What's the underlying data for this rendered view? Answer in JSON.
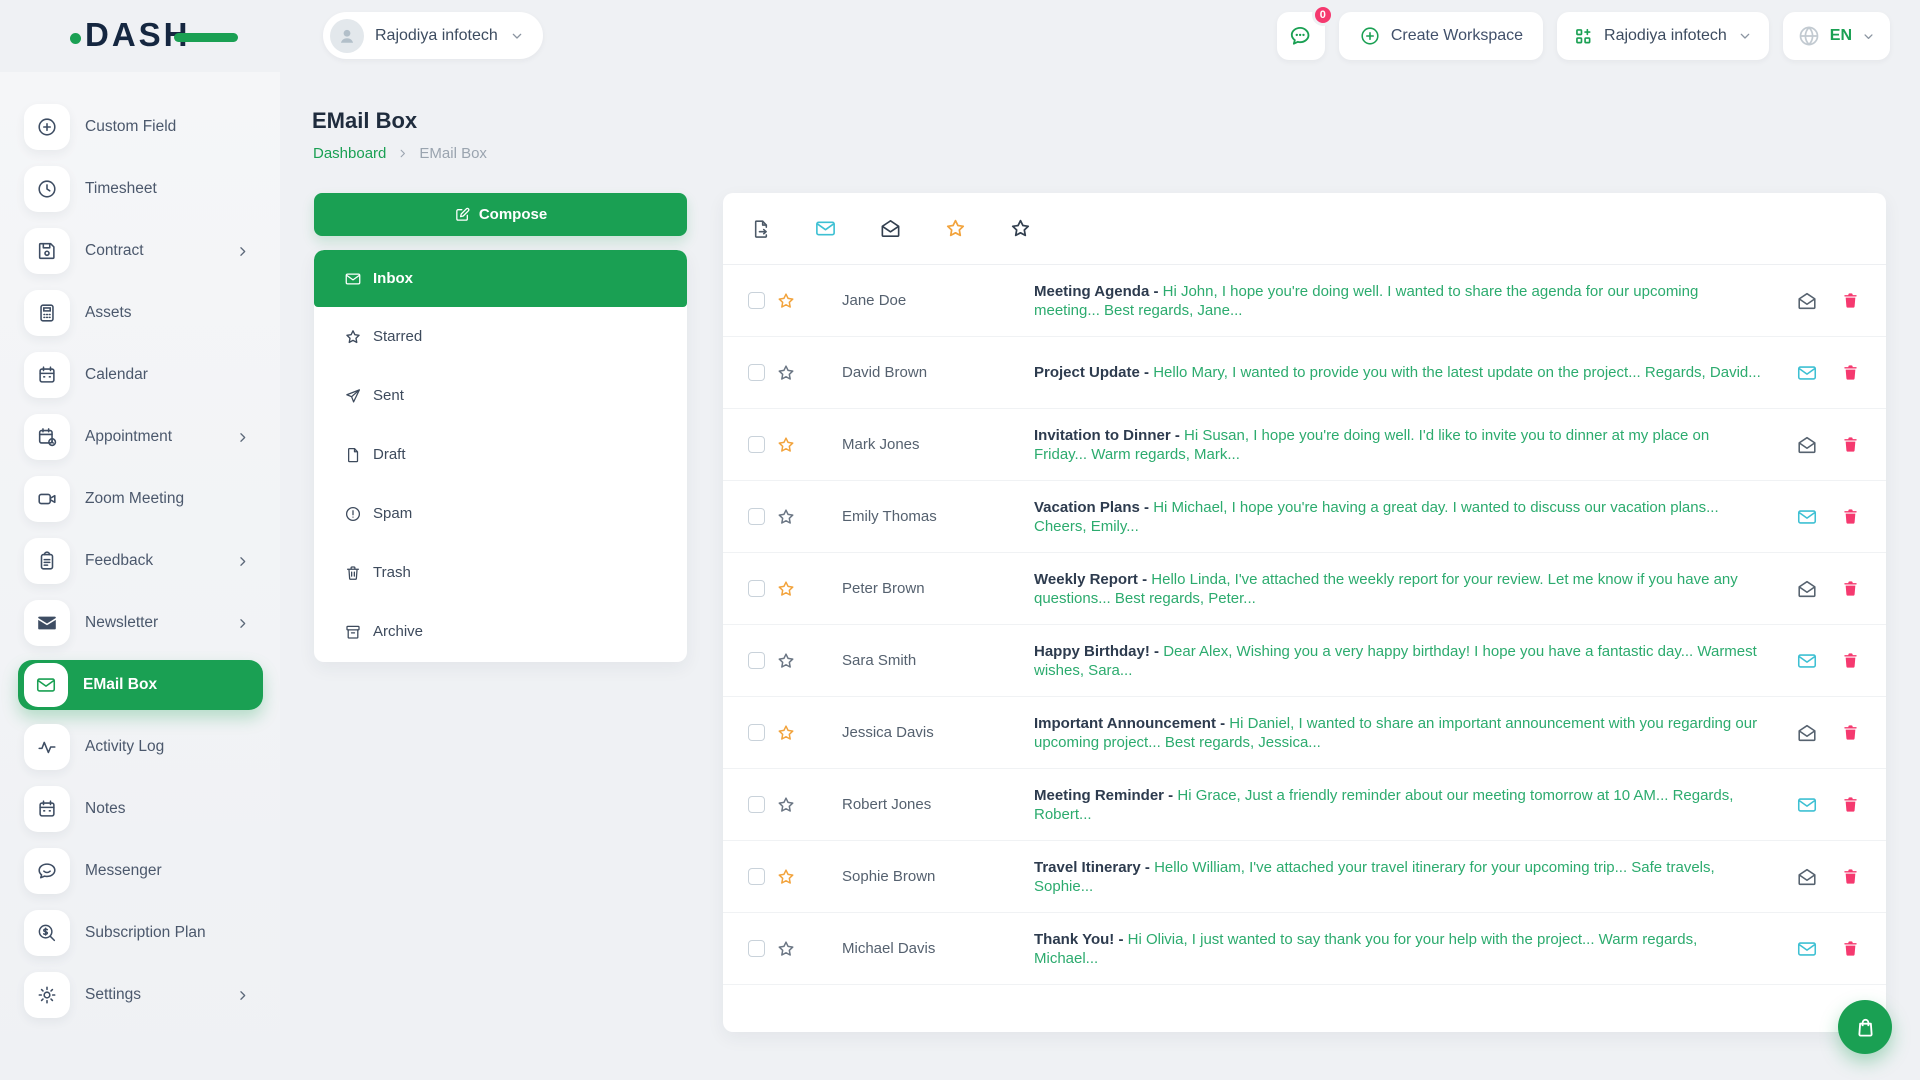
{
  "colors": {
    "accent_green": "#1aa053",
    "preview_green": "#2cab6e",
    "pink": "#f5396f",
    "cyan": "#3ec0d3",
    "star_orange": "#f2a33c",
    "dark_navy": "#152740"
  },
  "brand": {
    "logo_text": "DASH"
  },
  "header": {
    "user_dropdown": {
      "label": "Rajodiya infotech",
      "icon": "avatar-person-icon"
    },
    "chat": {
      "icon": "chat-bubble-icon",
      "badge": "0"
    },
    "create_workspace": {
      "label": "Create Workspace",
      "icon": "plus-circle-icon"
    },
    "workspace_dropdown": {
      "label": "Rajodiya infotech",
      "icon": "workspace-grid-icon"
    },
    "language": {
      "code": "EN",
      "icon": "globe-icon"
    }
  },
  "sidebar": {
    "items": [
      {
        "label": "Custom Field",
        "icon": "plus-circle-icon"
      },
      {
        "label": "Timesheet",
        "icon": "clock-icon"
      },
      {
        "label": "Contract",
        "icon": "save-icon",
        "has_submenu": true
      },
      {
        "label": "Assets",
        "icon": "calculator-icon"
      },
      {
        "label": "Calendar",
        "icon": "calendar-icon"
      },
      {
        "label": "Appointment",
        "icon": "calendar-clock-icon",
        "has_submenu": true
      },
      {
        "label": "Zoom Meeting",
        "icon": "video-camera-icon"
      },
      {
        "label": "Feedback",
        "icon": "clipboard-icon",
        "has_submenu": true
      },
      {
        "label": "Newsletter",
        "icon": "envelope-filled-icon",
        "has_submenu": true
      },
      {
        "label": "EMail Box",
        "icon": "envelope-icon",
        "active": true
      },
      {
        "label": "Activity Log",
        "icon": "activity-icon"
      },
      {
        "label": "Notes",
        "icon": "notes-calendar-icon"
      },
      {
        "label": "Messenger",
        "icon": "messenger-icon"
      },
      {
        "label": "Subscription Plan",
        "icon": "search-dollar-icon"
      },
      {
        "label": "Settings",
        "icon": "gear-icon",
        "has_submenu": true
      }
    ]
  },
  "page": {
    "title": "EMail Box",
    "breadcrumb": {
      "parent": "Dashboard",
      "current": "EMail Box"
    }
  },
  "mailbox": {
    "compose_label": "Compose",
    "folders": [
      {
        "label": "Inbox",
        "icon": "inbox-envelope-icon",
        "active": true
      },
      {
        "label": "Starred",
        "icon": "star-icon"
      },
      {
        "label": "Sent",
        "icon": "send-icon"
      },
      {
        "label": "Draft",
        "icon": "file-icon"
      },
      {
        "label": "Spam",
        "icon": "alert-circle-icon"
      },
      {
        "label": "Trash",
        "icon": "trash-icon"
      },
      {
        "label": "Archive",
        "icon": "archive-icon"
      }
    ],
    "toolbar": [
      {
        "name": "export-note-icon"
      },
      {
        "name": "mark-unread-envelope-icon"
      },
      {
        "name": "mark-read-envelope-icon"
      },
      {
        "name": "starred-filter-icon"
      },
      {
        "name": "unstarred-filter-icon"
      }
    ],
    "rows": [
      {
        "sender": "Jane Doe",
        "subject": "Meeting Agenda -",
        "preview": "Hi John, I hope you're doing well. I wanted to share the agenda for our upcoming meeting... Best regards, Jane...",
        "starred": true,
        "unread": false
      },
      {
        "sender": "David Brown",
        "subject": "Project Update -",
        "preview": "Hello Mary, I wanted to provide you with the latest update on the project... Regards, David...",
        "starred": false,
        "unread": true
      },
      {
        "sender": "Mark Jones",
        "subject": "Invitation to Dinner -",
        "preview": "Hi Susan, I hope you're doing well. I'd like to invite you to dinner at my place on Friday... Warm regards, Mark...",
        "starred": true,
        "unread": false
      },
      {
        "sender": "Emily Thomas",
        "subject": "Vacation Plans -",
        "preview": "Hi Michael, I hope you're having a great day. I wanted to discuss our vacation plans... Cheers, Emily...",
        "starred": false,
        "unread": true
      },
      {
        "sender": "Peter Brown",
        "subject": "Weekly Report -",
        "preview": "Hello Linda, I've attached the weekly report for your review. Let me know if you have any questions... Best regards, Peter...",
        "starred": true,
        "unread": false
      },
      {
        "sender": "Sara Smith",
        "subject": "Happy Birthday! -",
        "preview": "Dear Alex, Wishing you a very happy birthday! I hope you have a fantastic day... Warmest wishes, Sara...",
        "starred": false,
        "unread": true
      },
      {
        "sender": "Jessica Davis",
        "subject": "Important Announcement -",
        "preview": "Hi Daniel, I wanted to share an important announcement with you regarding our upcoming project... Best regards, Jessica...",
        "starred": true,
        "unread": false
      },
      {
        "sender": "Robert Jones",
        "subject": "Meeting Reminder -",
        "preview": "Hi Grace, Just a friendly reminder about our meeting tomorrow at 10 AM... Regards, Robert...",
        "starred": false,
        "unread": true
      },
      {
        "sender": "Sophie Brown",
        "subject": "Travel Itinerary -",
        "preview": "Hello William, I've attached your travel itinerary for your upcoming trip... Safe travels, Sophie...",
        "starred": true,
        "unread": false
      },
      {
        "sender": "Michael Davis",
        "subject": "Thank You! -",
        "preview": "Hi Olivia, I just wanted to say thank you for your help with the project... Warm regards, Michael...",
        "starred": false,
        "unread": true
      }
    ]
  }
}
